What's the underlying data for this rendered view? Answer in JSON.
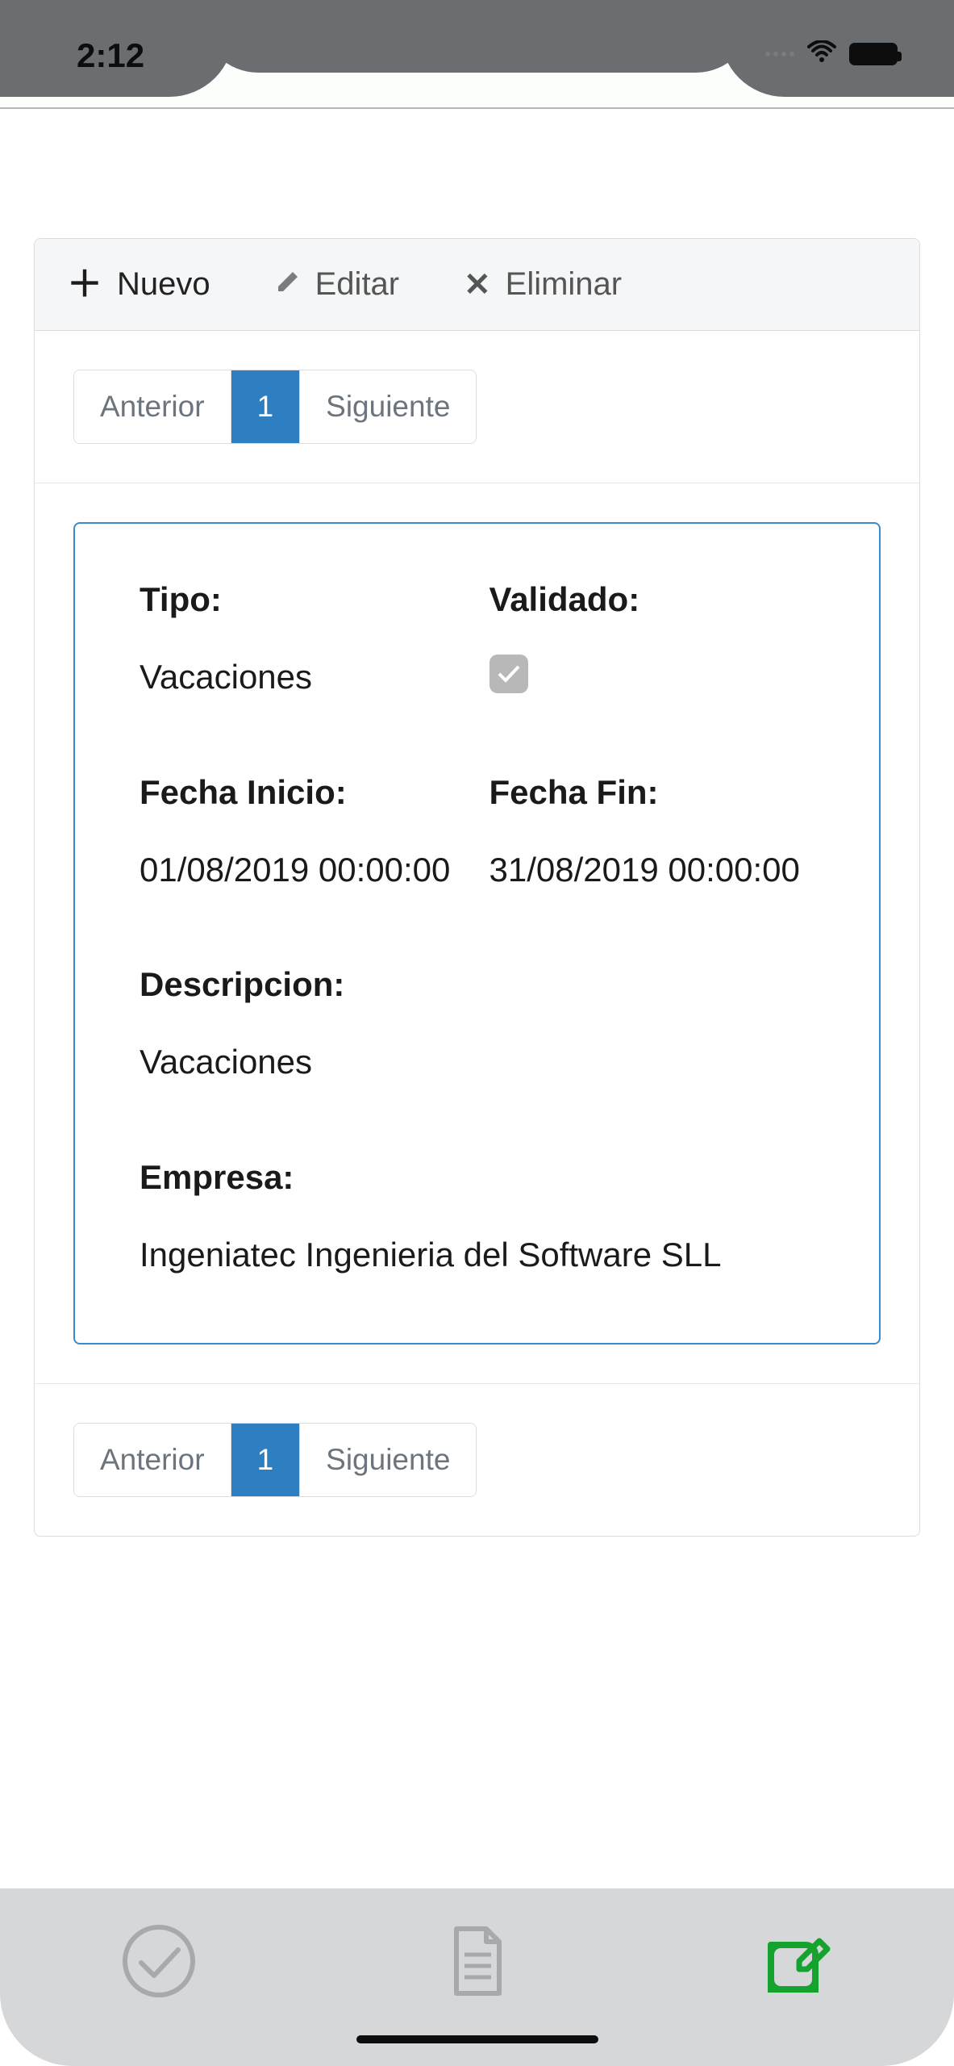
{
  "statusbar": {
    "time": "2:12"
  },
  "toolbar": {
    "nuevo": "Nuevo",
    "editar": "Editar",
    "eliminar": "Eliminar"
  },
  "pager": {
    "prev": "Anterior",
    "page": "1",
    "next": "Siguiente"
  },
  "record": {
    "tipo_label": "Tipo:",
    "tipo_value": "Vacaciones",
    "validado_label": "Validado:",
    "fecha_inicio_label": "Fecha Inicio:",
    "fecha_inicio_value": "01/08/2019 00:00:00",
    "fecha_fin_label": "Fecha Fin:",
    "fecha_fin_value": "31/08/2019 00:00:00",
    "descripcion_label": "Descripcion:",
    "descripcion_value": "Vacaciones",
    "empresa_label": "Empresa:",
    "empresa_value": "Ingeniatec Ingenieria del Software SLL"
  },
  "tabs": {
    "active_color": "#15a22f",
    "inactive_color": "#a7a9ab"
  }
}
